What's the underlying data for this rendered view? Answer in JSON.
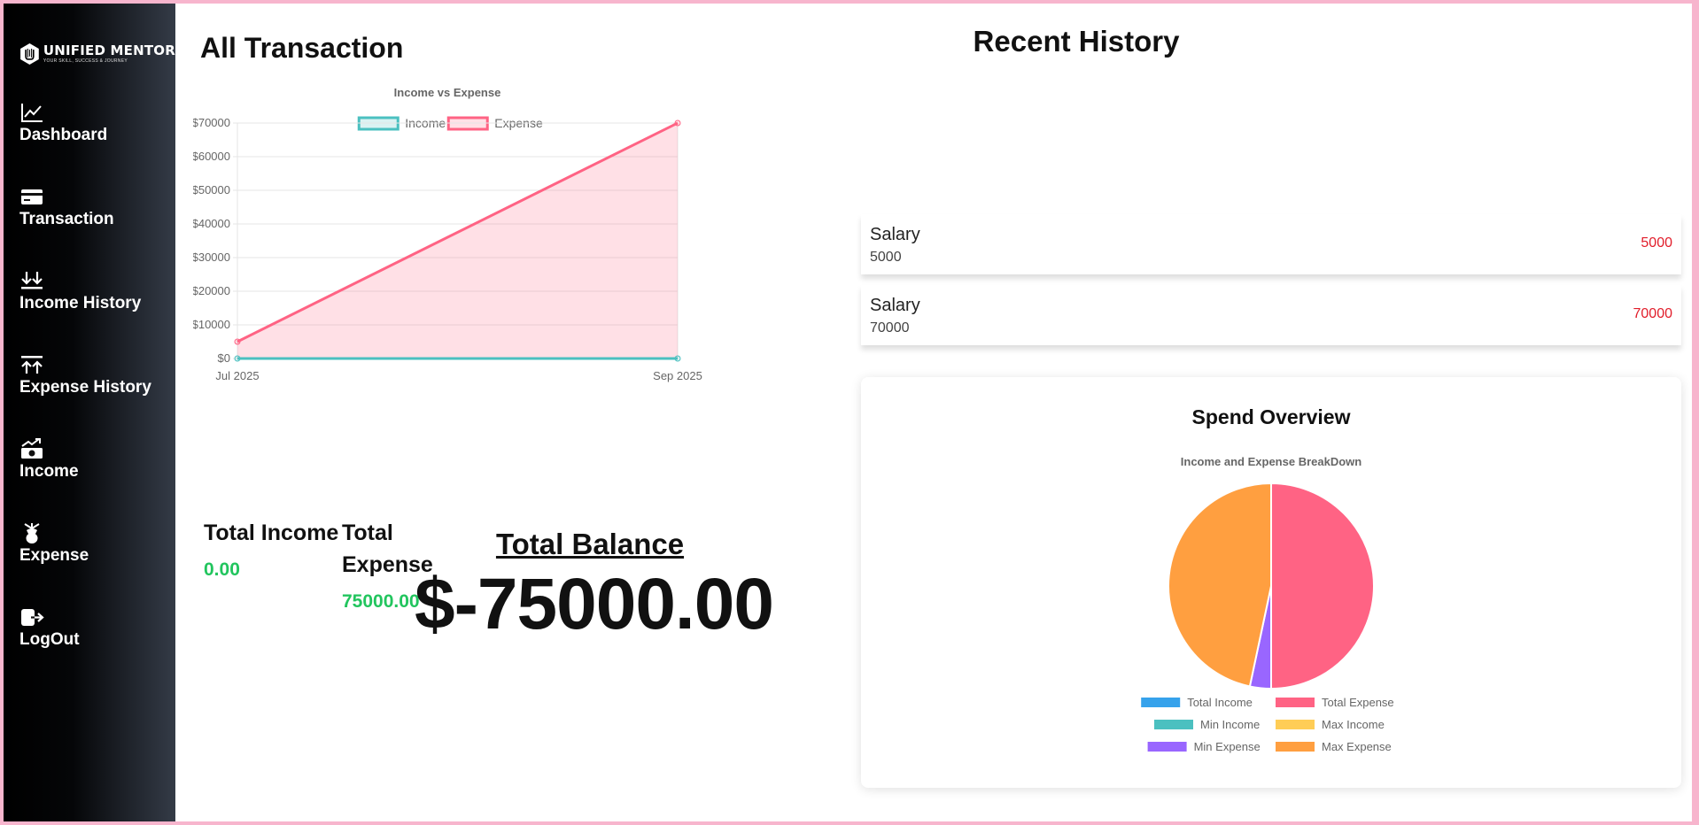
{
  "brand": {
    "name": "UNIFIED MENTOR",
    "tagline": "YOUR SKILL, SUCCESS & JOURNEY"
  },
  "sidebar": {
    "items": [
      {
        "label": "Dashboard",
        "icon": "chart-line-icon"
      },
      {
        "label": "Transaction",
        "icon": "credit-card-icon"
      },
      {
        "label": "Income History",
        "icon": "arrows-down-icon"
      },
      {
        "label": "Expense History",
        "icon": "arrows-up-icon"
      },
      {
        "label": "Income",
        "icon": "money-trend-icon"
      },
      {
        "label": "Expense",
        "icon": "expense-icon"
      },
      {
        "label": "LogOut",
        "icon": "logout-icon"
      }
    ]
  },
  "main": {
    "title": "All Transaction",
    "totals": {
      "income_label": "Total Income",
      "income_value": "0.00",
      "expense_label": "Total Expense",
      "expense_value": "75000.00",
      "balance_label": "Total Balance",
      "balance_value": "$-75000.00"
    }
  },
  "recent": {
    "title": "Recent History",
    "items": [
      {
        "title": "Salary",
        "sub": "5000",
        "amount": "5000"
      },
      {
        "title": "Salary",
        "sub": "70000",
        "amount": "70000"
      }
    ]
  },
  "spend": {
    "title": "Spend Overview"
  },
  "colors": {
    "income": "#4bc0c0",
    "expense": "#ff6384",
    "total_income": "#36a2eb",
    "max_income": "#ffcd56",
    "min_expense": "#9966ff",
    "max_expense": "#ff9f40",
    "positive": "#22c55e",
    "negative": "#e11d2a"
  },
  "chart_data": [
    {
      "type": "line",
      "title": "Income vs Expense",
      "x": [
        "Jul 2025",
        "Sep 2025"
      ],
      "series": [
        {
          "name": "Income",
          "values": [
            0,
            0
          ],
          "color": "#4bc0c0",
          "fill": "rgba(75,192,192,0.2)"
        },
        {
          "name": "Expense",
          "values": [
            5000,
            70000
          ],
          "color": "#ff6384",
          "fill": "rgba(255,99,132,0.2)"
        }
      ],
      "yticks": [
        "$0",
        "$10000",
        "$20000",
        "$30000",
        "$40000",
        "$50000",
        "$60000",
        "$70000"
      ],
      "ylim": [
        0,
        70000
      ],
      "grid": true,
      "legend": "top"
    },
    {
      "type": "pie",
      "title": "Income and Expense BreakDown",
      "labels": [
        "Total Income",
        "Total Expense",
        "Min Income",
        "Max Income",
        "Min Expense",
        "Max Expense"
      ],
      "values": [
        0,
        75000,
        0,
        0,
        5000,
        70000
      ],
      "colors": [
        "#36a2eb",
        "#ff6384",
        "#4bc0c0",
        "#ffcd56",
        "#9966ff",
        "#ff9f40"
      ],
      "legend": "bottom"
    }
  ]
}
